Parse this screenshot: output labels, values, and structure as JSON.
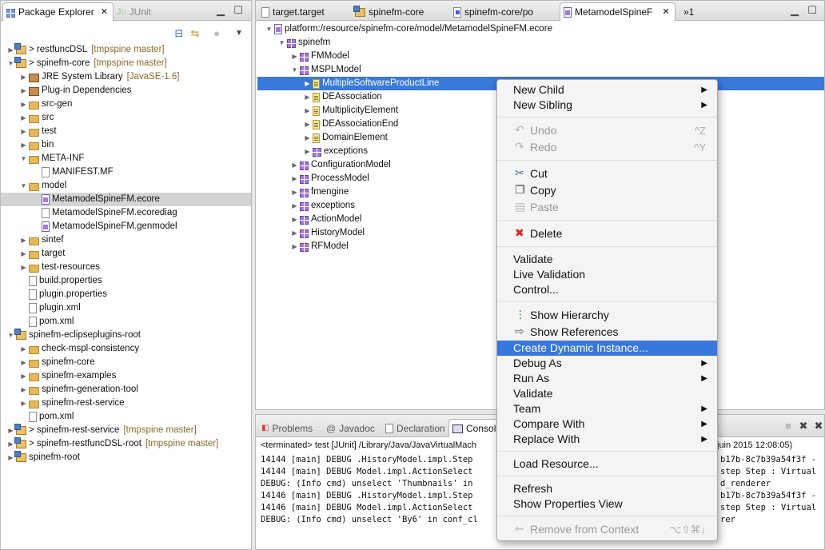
{
  "package_explorer": {
    "tab_label": "Package Explorer",
    "tab_close": "✕",
    "junit_tab_label": "JUnit",
    "tree": [
      {
        "label": "> restfuncDSL",
        "git": "[tmpspine master]",
        "icon": "proj",
        "depth": 0,
        "tw": "▶"
      },
      {
        "label": "> spinefm-core",
        "git": "[tmpspine master]",
        "icon": "proj",
        "depth": 0,
        "tw": "▼"
      },
      {
        "label": "JRE System Library",
        "git": "[JavaSE-1.6]",
        "icon": "lib",
        "depth": 1,
        "tw": "▶"
      },
      {
        "label": "Plug-in Dependencies",
        "git": "",
        "icon": "lib",
        "depth": 1,
        "tw": "▶"
      },
      {
        "label": "src-gen",
        "git": "",
        "icon": "folder",
        "depth": 1,
        "tw": "▶"
      },
      {
        "label": "src",
        "git": "",
        "icon": "folder",
        "depth": 1,
        "tw": "▶"
      },
      {
        "label": "test",
        "git": "",
        "icon": "folder",
        "depth": 1,
        "tw": "▶"
      },
      {
        "label": "bin",
        "git": "",
        "icon": "folder",
        "depth": 1,
        "tw": "▶"
      },
      {
        "label": "META-INF",
        "git": "",
        "icon": "folder",
        "depth": 1,
        "tw": "▼"
      },
      {
        "label": "MANIFEST.MF",
        "git": "",
        "icon": "file",
        "depth": 2,
        "tw": ""
      },
      {
        "label": "model",
        "git": "",
        "icon": "folder",
        "depth": 1,
        "tw": "▼"
      },
      {
        "label": "MetamodelSpineFM.ecore",
        "git": "",
        "icon": "res",
        "depth": 2,
        "tw": "",
        "sel": true
      },
      {
        "label": "MetamodelSpineFM.ecorediag",
        "git": "",
        "icon": "file",
        "depth": 2,
        "tw": ""
      },
      {
        "label": "MetamodelSpineFM.genmodel",
        "git": "",
        "icon": "res",
        "depth": 2,
        "tw": ""
      },
      {
        "label": "sintef",
        "git": "",
        "icon": "folder",
        "depth": 1,
        "tw": "▶"
      },
      {
        "label": "target",
        "git": "",
        "icon": "folder",
        "depth": 1,
        "tw": "▶"
      },
      {
        "label": "test-resources",
        "git": "",
        "icon": "folder",
        "depth": 1,
        "tw": "▶"
      },
      {
        "label": "build.properties",
        "git": "",
        "icon": "file",
        "depth": 1,
        "tw": ""
      },
      {
        "label": "plugin.properties",
        "git": "",
        "icon": "file",
        "depth": 1,
        "tw": ""
      },
      {
        "label": "plugin.xml",
        "git": "",
        "icon": "file",
        "depth": 1,
        "tw": ""
      },
      {
        "label": "pom.xml",
        "git": "",
        "icon": "file",
        "depth": 1,
        "tw": ""
      },
      {
        "label": "spinefm-eclipseplugins-root",
        "git": "",
        "icon": "proj",
        "depth": 0,
        "tw": "▼"
      },
      {
        "label": "check-mspl-consistency",
        "git": "",
        "icon": "folder",
        "depth": 1,
        "tw": "▶"
      },
      {
        "label": "spinefm-core",
        "git": "",
        "icon": "folder",
        "depth": 1,
        "tw": "▶"
      },
      {
        "label": "spinefm-examples",
        "git": "",
        "icon": "folder",
        "depth": 1,
        "tw": "▶"
      },
      {
        "label": "spinefm-generation-tool",
        "git": "",
        "icon": "folder",
        "depth": 1,
        "tw": "▶"
      },
      {
        "label": "spinefm-rest-service",
        "git": "",
        "icon": "folder",
        "depth": 1,
        "tw": "▶"
      },
      {
        "label": "pom.xml",
        "git": "",
        "icon": "file",
        "depth": 1,
        "tw": ""
      },
      {
        "label": "> spinefm-rest-service",
        "git": "[tmpspine master]",
        "icon": "proj",
        "depth": 0,
        "tw": "▶"
      },
      {
        "label": "> spinefm-restfuncDSL-root",
        "git": "[tmpspine master]",
        "icon": "proj",
        "depth": 0,
        "tw": "▶"
      },
      {
        "label": "spinefm-root",
        "git": "",
        "icon": "proj",
        "depth": 0,
        "tw": "▶"
      }
    ]
  },
  "editor": {
    "tabs": [
      {
        "label": "target.target",
        "active": false
      },
      {
        "label": "spinefm-core",
        "active": false
      },
      {
        "label": "spinefm-core/po",
        "active": false
      },
      {
        "label": "MetamodelSpineF",
        "active": true
      }
    ],
    "overflow": "»1",
    "tree": [
      {
        "label": "platform:/resource/spinefm-core/model/MetamodelSpineFM.ecore",
        "icon": "res",
        "depth": 0,
        "tw": "▼"
      },
      {
        "label": "spinefm",
        "icon": "pkg",
        "depth": 1,
        "tw": "▼"
      },
      {
        "label": "FMModel",
        "icon": "pkg",
        "depth": 2,
        "tw": "▶"
      },
      {
        "label": "MSPLModel",
        "icon": "pkg",
        "depth": 2,
        "tw": "▼"
      },
      {
        "label": "MultipleSoftwareProductLine",
        "icon": "cls",
        "depth": 3,
        "tw": "▶",
        "sel": true
      },
      {
        "label": "DEAssociation",
        "icon": "cls",
        "depth": 3,
        "tw": "▶"
      },
      {
        "label": "MultiplicityElement",
        "icon": "cls",
        "depth": 3,
        "tw": "▶"
      },
      {
        "label": "DEAssociationEnd",
        "icon": "cls",
        "depth": 3,
        "tw": "▶"
      },
      {
        "label": "DomainElement",
        "icon": "cls",
        "depth": 3,
        "tw": "▶"
      },
      {
        "label": "exceptions",
        "icon": "pkg",
        "depth": 3,
        "tw": "▶"
      },
      {
        "label": "ConfigurationModel",
        "icon": "pkg",
        "depth": 2,
        "tw": "▶"
      },
      {
        "label": "ProcessModel",
        "icon": "pkg",
        "depth": 2,
        "tw": "▶"
      },
      {
        "label": "fmengine",
        "icon": "pkg",
        "depth": 2,
        "tw": "▶"
      },
      {
        "label": "exceptions",
        "icon": "pkg",
        "depth": 2,
        "tw": "▶"
      },
      {
        "label": "ActionModel",
        "icon": "pkg",
        "depth": 2,
        "tw": "▶"
      },
      {
        "label": "HistoryModel",
        "icon": "pkg",
        "depth": 2,
        "tw": "▶"
      },
      {
        "label": "RFModel",
        "icon": "pkg",
        "depth": 2,
        "tw": "▶"
      }
    ]
  },
  "bottom": {
    "tabs": [
      "Problems",
      "Javadoc",
      "Declaration",
      "Consol"
    ],
    "terminated": "<terminated> test [JUnit] /Library/Java/JavaVirtualMach",
    "terminated_right": "juin 2015 12:08:05)",
    "lines": [
      {
        "left": "14144 [main] DEBUG .HistoryModel.impl.Step",
        "right": "b17b-8c7b39a54f3f -"
      },
      {
        "left": "14144 [main] DEBUG Model.impl.ActionSelect",
        "right": "step Step : Virtual"
      },
      {
        "left": "DEBUG: (Info cmd) unselect 'Thumbnails' in",
        "right": "d_renderer"
      },
      {
        "left": "14146 [main] DEBUG .HistoryModel.impl.Step",
        "right": "b17b-8c7b39a54f3f -"
      },
      {
        "left": "14146 [main] DEBUG Model.impl.ActionSelect",
        "right": "step Step : Virtual"
      },
      {
        "left": "DEBUG: (Info cmd) unselect 'By6' in conf_cl",
        "right": "rer"
      }
    ]
  },
  "context_menu": {
    "items": [
      {
        "label": "New Child",
        "arrow": true
      },
      {
        "label": "New Sibling",
        "arrow": true
      },
      {
        "sep": true
      },
      {
        "label": "Undo",
        "disabled": true,
        "shortcut": "^Z",
        "icon": "undo"
      },
      {
        "label": "Redo",
        "disabled": true,
        "shortcut": "^Y",
        "icon": "redo"
      },
      {
        "sep": true
      },
      {
        "label": "Cut",
        "icon": "cut"
      },
      {
        "label": "Copy",
        "icon": "copy"
      },
      {
        "label": "Paste",
        "disabled": true,
        "icon": "paste"
      },
      {
        "sep": true
      },
      {
        "label": "Delete",
        "icon": "delete"
      },
      {
        "sep": true
      },
      {
        "label": "Validate"
      },
      {
        "label": "Live Validation"
      },
      {
        "label": "Control..."
      },
      {
        "sep": true
      },
      {
        "label": "Show Hierarchy",
        "icon": "hierarchy"
      },
      {
        "label": "Show References",
        "icon": "refs"
      },
      {
        "label": "Create Dynamic Instance...",
        "highlight": true
      },
      {
        "label": "Debug As",
        "arrow": true
      },
      {
        "label": "Run As",
        "arrow": true
      },
      {
        "label": "Validate"
      },
      {
        "label": "Team",
        "arrow": true
      },
      {
        "label": "Compare With",
        "arrow": true
      },
      {
        "label": "Replace With",
        "arrow": true
      },
      {
        "sep": true
      },
      {
        "label": "Load Resource..."
      },
      {
        "sep": true
      },
      {
        "label": "Refresh"
      },
      {
        "label": "Show Properties View"
      },
      {
        "sep": true
      },
      {
        "label": "Remove from Context",
        "disabled": true,
        "shortcut": "⌥⇧⌘↓",
        "icon": "remove"
      }
    ]
  }
}
